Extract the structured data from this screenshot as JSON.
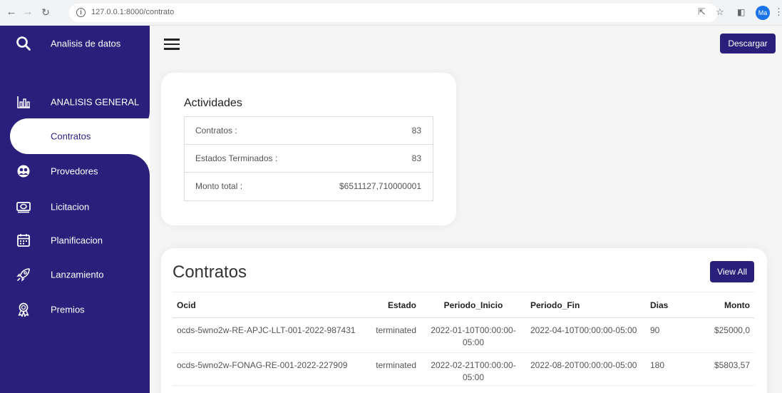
{
  "browser": {
    "url": "127.0.0.1:8000/contrato",
    "profile_initials": "Ma"
  },
  "sidebar": {
    "header_label": "Analisis de datos",
    "items": [
      {
        "label": "ANALISIS GENERAL",
        "icon": "bar-chart-icon"
      },
      {
        "label": "Contratos",
        "icon": "",
        "active": true
      },
      {
        "label": "Provedores",
        "icon": "people-icon"
      },
      {
        "label": "Licitacion",
        "icon": "money-icon"
      },
      {
        "label": "Planificacion",
        "icon": "calendar-icon"
      },
      {
        "label": "Lanzamiento",
        "icon": "rocket-icon"
      },
      {
        "label": "Premios",
        "icon": "award-icon"
      }
    ]
  },
  "toolbar": {
    "download_label": "Descargar"
  },
  "activities": {
    "title": "Actividades",
    "rows": [
      {
        "label": "Contratos :",
        "value": "83"
      },
      {
        "label": "Estados Terminados :",
        "value": "83"
      },
      {
        "label": "Monto total :",
        "value": "$6511127,710000001"
      }
    ]
  },
  "contracts": {
    "title": "Contratos",
    "view_all_label": "View All",
    "columns": [
      "Ocid",
      "Estado",
      "Periodo_Inicio",
      "Periodo_Fin",
      "Dias",
      "Monto"
    ],
    "rows": [
      {
        "ocid": "ocds-5wno2w-RE-APJC-LLT-001-2022-987431",
        "estado": "terminated",
        "inicio": "2022-01-10T00:00:00-05:00",
        "fin": "2022-04-10T00:00:00-05:00",
        "dias": "90",
        "monto": "$25000,0"
      },
      {
        "ocid": "ocds-5wno2w-FONAG-RE-001-2022-227909",
        "estado": "terminated",
        "inicio": "2022-02-21T00:00:00-05:00",
        "fin": "2022-08-20T00:00:00-05:00",
        "dias": "180",
        "monto": "$5803,57"
      }
    ]
  },
  "colors": {
    "primary": "#2b1f7c",
    "background": "#f5f5f5"
  }
}
